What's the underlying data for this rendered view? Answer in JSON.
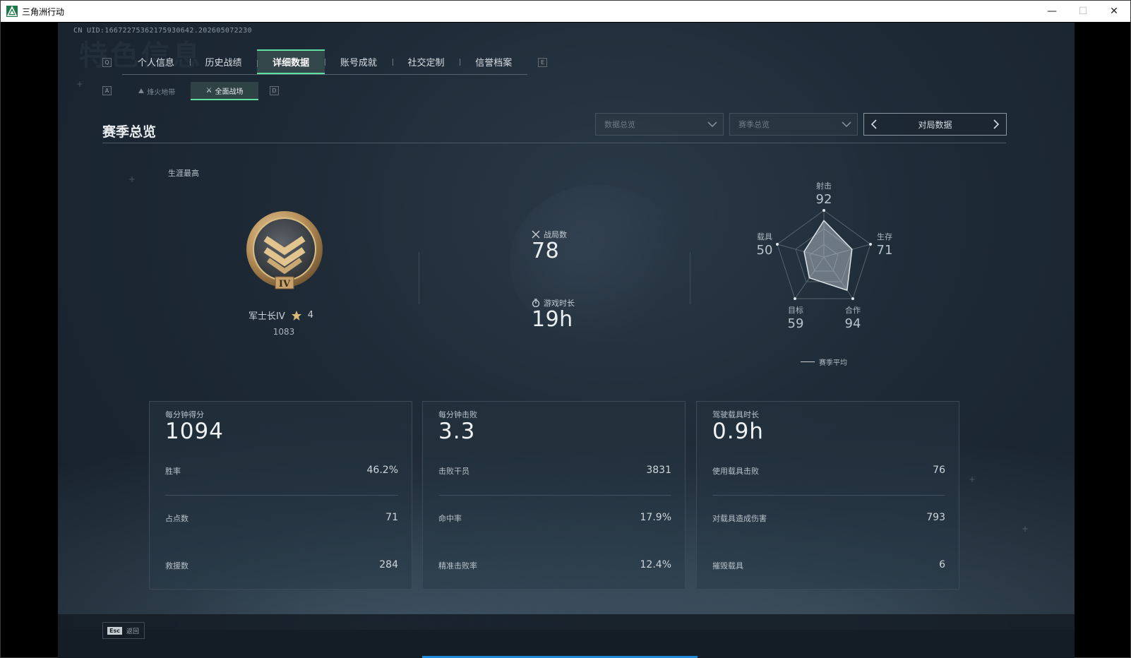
{
  "window": {
    "title": "三角洲行动",
    "minimize": "—",
    "maximize": "☐",
    "close": "✕"
  },
  "uid": "CN UID:16672275362175930642.202605072230",
  "ghost_title": "特色信息",
  "tabs": {
    "left_key": "Q",
    "right_key": "E",
    "items": [
      {
        "label": "个人信息"
      },
      {
        "label": "历史战绩"
      },
      {
        "label": "详细数据",
        "active": true
      },
      {
        "label": "账号成就"
      },
      {
        "label": "社交定制"
      },
      {
        "label": "信誉档案"
      }
    ]
  },
  "subtabs": {
    "left_key": "A",
    "right_key": "D",
    "items": [
      {
        "label": "烽火地带"
      },
      {
        "label": "全面战场",
        "active": true
      }
    ]
  },
  "section": {
    "title": "赛季总览"
  },
  "filters": {
    "data_overview": "数据总览",
    "season_overview": "赛季总览",
    "pager_label": "对局数据"
  },
  "career": {
    "label": "生涯最高",
    "rank_name": "军士长IV",
    "stars": "4",
    "score": "1083",
    "badge_numeral": "IV"
  },
  "summary": {
    "matches_label": "战局数",
    "matches_value": "78",
    "playtime_label": "游戏时长",
    "playtime_value": "19h"
  },
  "radar": {
    "axes": [
      {
        "label": "射击",
        "value": "92"
      },
      {
        "label": "生存",
        "value": "71"
      },
      {
        "label": "合作",
        "value": "94"
      },
      {
        "label": "目标",
        "value": "59"
      },
      {
        "label": "载具",
        "value": "50"
      }
    ],
    "legend": "赛季平均"
  },
  "cards": [
    {
      "head": "每分钟得分",
      "big": "1094",
      "rows": [
        {
          "label": "胜率",
          "value": "46.2%"
        },
        {
          "label": "占点数",
          "value": "71"
        },
        {
          "label": "救援数",
          "value": "284"
        }
      ]
    },
    {
      "head": "每分钟击败",
      "big": "3.3",
      "rows": [
        {
          "label": "击败干员",
          "value": "3831"
        },
        {
          "label": "命中率",
          "value": "17.9%"
        },
        {
          "label": "精准击败率",
          "value": "12.4%"
        }
      ]
    },
    {
      "head": "驾驶载具时长",
      "big": "0.9h",
      "rows": [
        {
          "label": "使用载具击败",
          "value": "76"
        },
        {
          "label": "对载具造成伤害",
          "value": "793"
        },
        {
          "label": "摧毁载具",
          "value": "6"
        }
      ]
    }
  ],
  "footer": {
    "esc_key": "Esc",
    "esc_label": "返回"
  },
  "colors": {
    "accent": "#5fe0a0",
    "bg": "#1d2935",
    "loadbar": "#1e88d8"
  }
}
